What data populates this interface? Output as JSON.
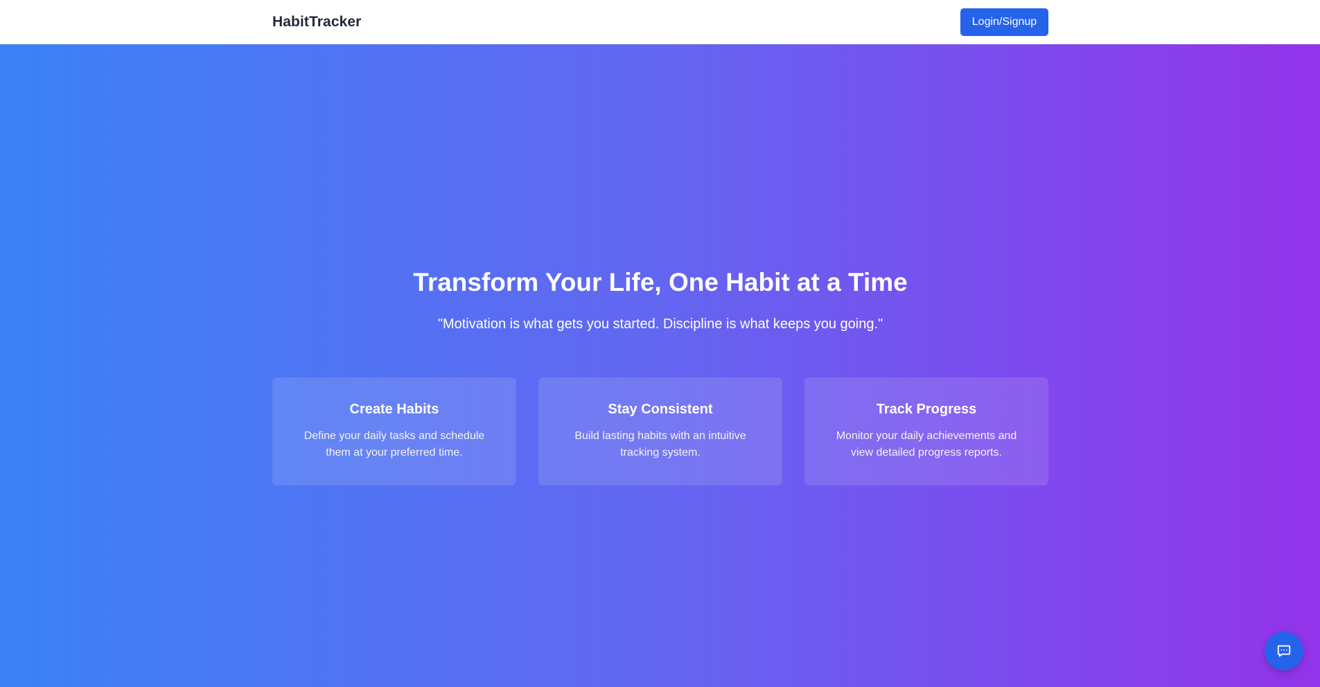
{
  "nav": {
    "brand": "HabitTracker",
    "login_label": "Login/Signup"
  },
  "hero": {
    "title": "Transform Your Life, One Habit at a Time",
    "quote": "\"Motivation is what gets you started. Discipline is what keeps you going.\""
  },
  "features": [
    {
      "title": "Create Habits",
      "description": "Define your daily tasks and schedule them at your preferred time."
    },
    {
      "title": "Stay Consistent",
      "description": "Build lasting habits with an intuitive tracking system."
    },
    {
      "title": "Track Progress",
      "description": "Monitor your daily achievements and view detailed progress reports."
    }
  ],
  "chat": {
    "icon": "chat-icon"
  },
  "colors": {
    "gradient_start": "#3b82f6",
    "gradient_mid": "#6366f1",
    "gradient_end": "#9333ea",
    "primary_button": "#2563eb",
    "brand_text": "#1f2937"
  }
}
